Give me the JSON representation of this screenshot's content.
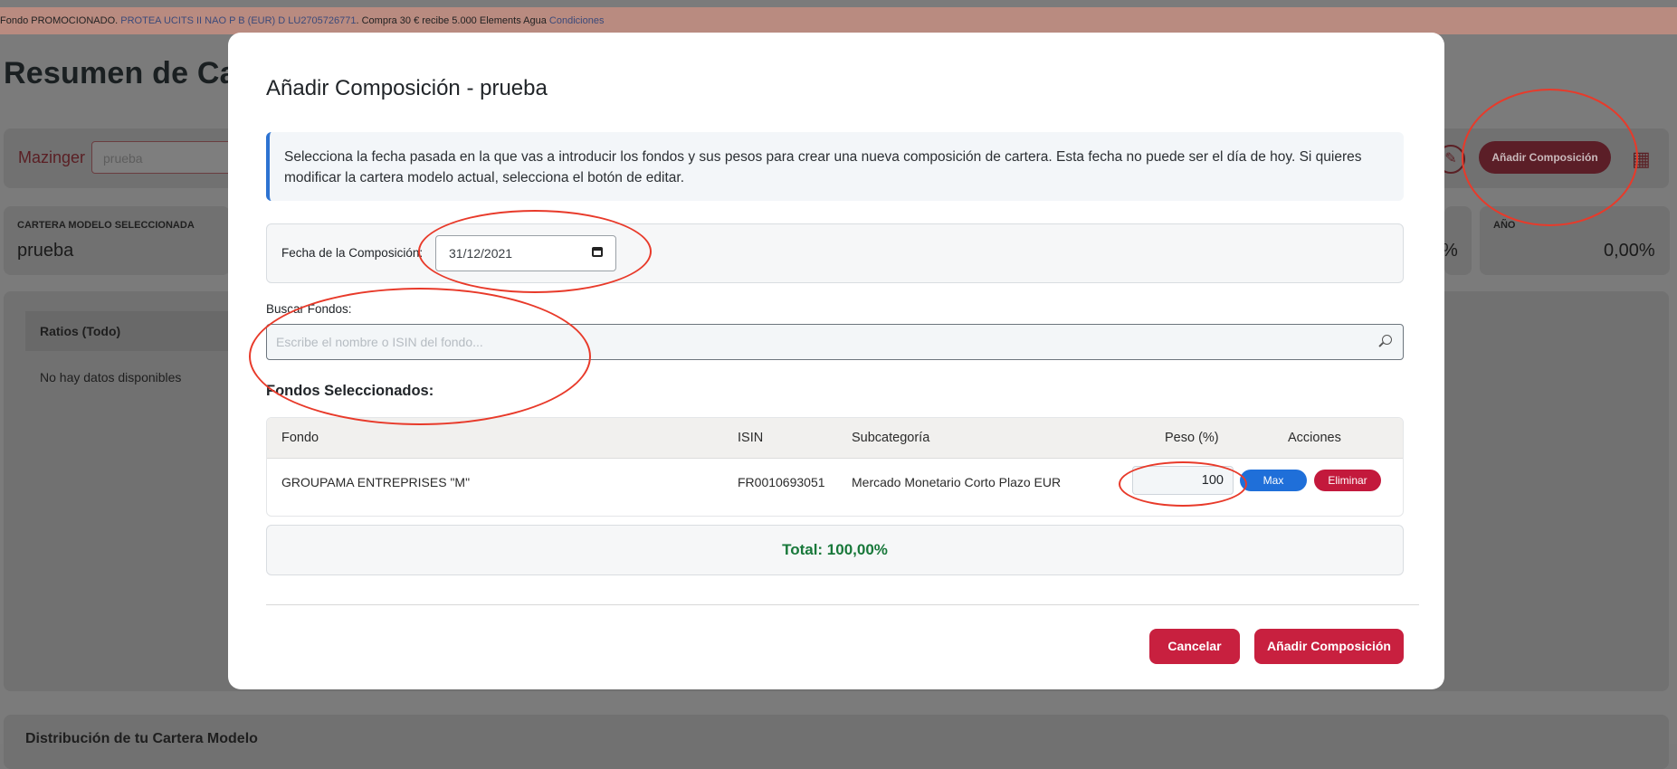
{
  "background": {
    "promo": {
      "prefix": "Fondo PROMOCIONADO.",
      "fund_link": "PROTEA UCITS II NAO P B (EUR) D LU2705726771",
      "text": ". Compra 30 € recibe 5.000 Elements Agua",
      "conditions_link": "Condiciones"
    },
    "page_title": "Resumen de Car",
    "selector_label": "Mazinger",
    "selector_value": "prueba",
    "add_composition_label": "Añadir Composición",
    "selected_portfolio_label": "CARTERA MODELO SELECCIONADA",
    "selected_portfolio_value": "prueba",
    "percent_partial": "%",
    "year_label": "AÑO",
    "year_value": "0,00%",
    "ratios_tab": "Ratios (Todo)",
    "no_data": "No hay datos disponibles",
    "distribution_title": "Distribución de tu Cartera Modelo"
  },
  "modal": {
    "title": "Añadir Composición - prueba",
    "info_text": "Selecciona la fecha pasada en la que vas a introducir los fondos y sus pesos para crear una nueva composición de cartera. Esta fecha no puede ser el día de hoy. Si quieres modificar la cartera modelo actual, selecciona el botón de editar.",
    "date_label": "Fecha de la Composición:",
    "date_value": "31/12/2021",
    "search_label": "Buscar Fondos:",
    "search_placeholder": "Escribe el nombre o ISIN del fondo...",
    "selected_title": "Fondos Seleccionados:",
    "table": {
      "headers": [
        "Fondo",
        "ISIN",
        "Subcategoría",
        "Peso (%)",
        "Acciones"
      ],
      "rows": [
        {
          "fund": "GROUPAMA ENTREPRISES \"M\"",
          "isin": "FR0010693051",
          "subcategory": "Mercado Monetario Corto Plazo EUR",
          "weight": "100",
          "max_label": "Max",
          "delete_label": "Eliminar"
        }
      ]
    },
    "total": "Total: 100,00%",
    "cancel_label": "Cancelar",
    "submit_label": "Añadir Composición"
  },
  "colors": {
    "accent": "#c8203f",
    "info_border": "#2d73d1",
    "total_green": "#18783a",
    "annotation_red": "#e83a2a"
  }
}
